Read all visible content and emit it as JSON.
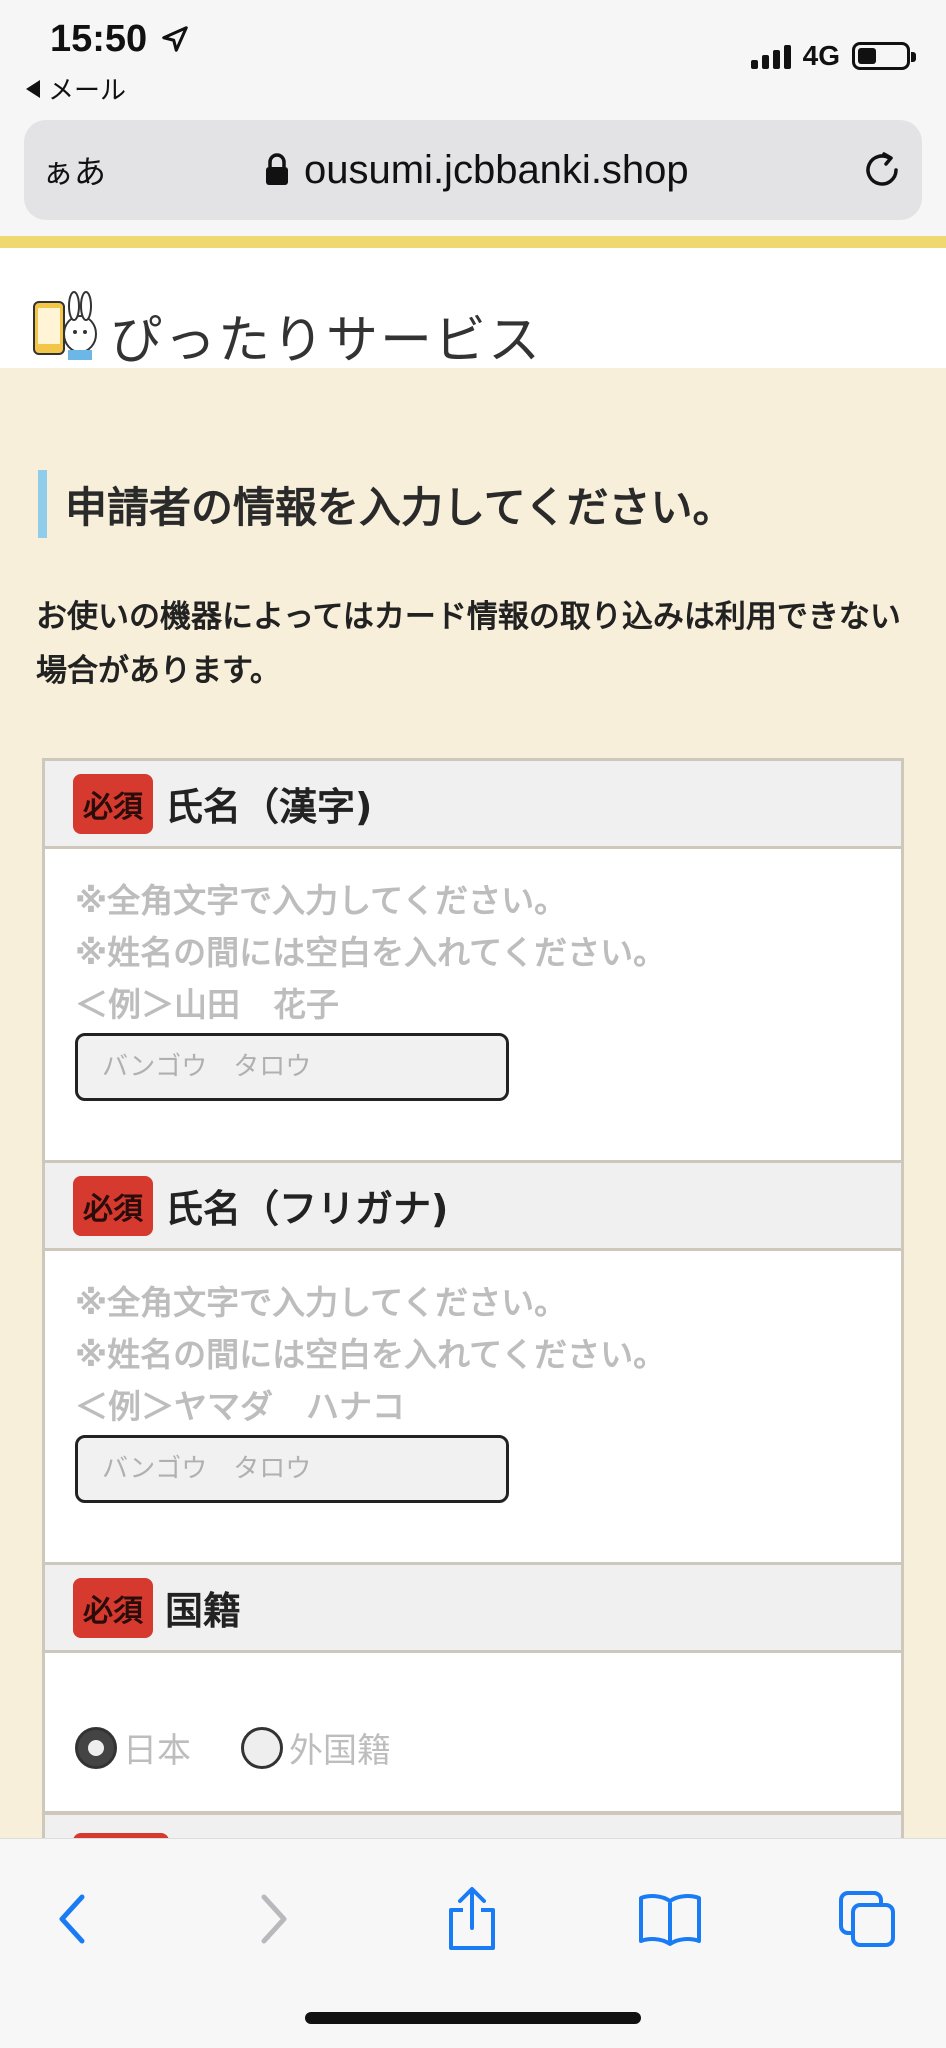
{
  "status_bar": {
    "time": "15:50",
    "back_label": "メール",
    "network": "4G",
    "battery_level": 0.4
  },
  "browser": {
    "aa_label": "ぁあ",
    "url": "ousumi.jcbbanki.shop"
  },
  "site": {
    "name": "ぴったりサービス"
  },
  "page": {
    "heading": "申請者の情報を入力してください。",
    "note": "お使いの機器によってはカード情報の取り込みは利用できない場合があります。"
  },
  "form": {
    "required_badge": "必須",
    "name_kanji": {
      "label": "氏名（漢字)",
      "hint1": "※全角文字で入力してください。",
      "hint2": "※姓名の間には空白を入れてください。",
      "example": "＜例＞山田　花子",
      "placeholder": "バンゴウ　タロウ"
    },
    "name_kana": {
      "label": "氏名（フリガナ)",
      "hint1": "※全角文字で入力してください。",
      "hint2": "※姓名の間には空白を入れてください。",
      "example": "＜例＞ヤマダ　ハナコ",
      "placeholder": "バンゴウ　タロウ"
    },
    "nationality": {
      "label": "国籍",
      "options": [
        "日本",
        "外国籍"
      ],
      "selected": "日本"
    }
  },
  "colors": {
    "page_bg": "#f7efd9",
    "accent_stripe": "#f0d870",
    "heading_bar": "#8fcdea",
    "required_badge": "#d63a2f",
    "browser_blue": "#1a7cf5"
  },
  "icons": {
    "location": "location-arrow-icon",
    "lock": "lock-icon",
    "reload": "reload-icon",
    "back": "chevron-left-icon",
    "forward": "chevron-right-icon",
    "share": "share-icon",
    "bookmarks": "book-icon",
    "tabs": "tabs-icon"
  }
}
